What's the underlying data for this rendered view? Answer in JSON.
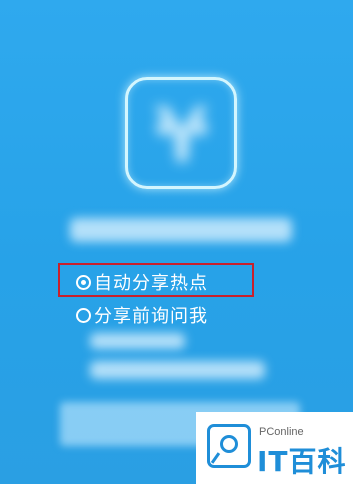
{
  "options": [
    {
      "label": "自动分享热点",
      "selected": true
    },
    {
      "label": "分享前询问我",
      "selected": false
    }
  ],
  "watermark": {
    "brand": "PConline",
    "name": "IT百科"
  },
  "colors": {
    "background": "#2aa7ec",
    "highlight_border": "#c8202c",
    "watermark_blue": "#1f8ed8"
  },
  "icons": [
    "app-icon",
    "radio-checked-icon",
    "radio-unchecked-icon",
    "pconline-logo-icon"
  ]
}
